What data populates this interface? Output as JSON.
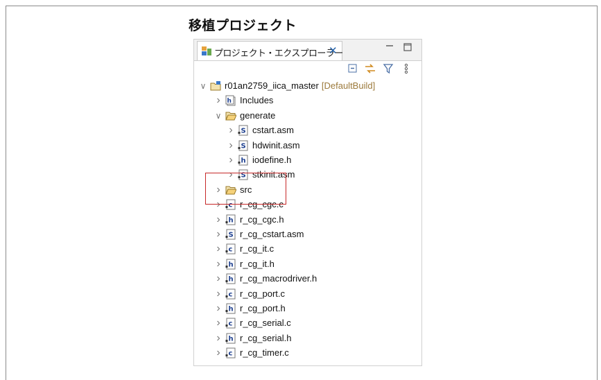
{
  "caption": "移植プロジェクト",
  "view": {
    "tab_label": "プロジェクト・エクスプローラー",
    "close_glyph": "✕",
    "minimize_glyph": "▭",
    "maximize_glyph": "□"
  },
  "tree": {
    "project": {
      "name": "r01an2759_iica_master",
      "decoration": "[DefaultBuild]"
    },
    "items": [
      {
        "label": "Includes",
        "icon": "includes-icon",
        "depth": 1,
        "expanded": false
      },
      {
        "label": "generate",
        "icon": "folder-open-icon",
        "depth": 1,
        "expanded": true
      },
      {
        "label": "cstart.asm",
        "icon": "asm-file-icon",
        "depth": 2,
        "expanded": false
      },
      {
        "label": "hdwinit.asm",
        "icon": "asm-file-icon",
        "depth": 2,
        "expanded": false
      },
      {
        "label": "iodefine.h",
        "icon": "header-file-icon",
        "depth": 2,
        "expanded": false
      },
      {
        "label": "stkinit.asm",
        "icon": "asm-file-icon",
        "depth": 2,
        "expanded": false
      },
      {
        "label": "src",
        "icon": "folder-open-icon",
        "depth": 1,
        "expanded": false
      },
      {
        "label": "r_cg_cgc.c",
        "icon": "c-file-icon",
        "depth": 1,
        "expanded": false
      },
      {
        "label": "r_cg_cgc.h",
        "icon": "header-file-icon",
        "depth": 1,
        "expanded": false
      },
      {
        "label": "r_cg_cstart.asm",
        "icon": "asm-file-icon",
        "depth": 1,
        "expanded": false
      },
      {
        "label": "r_cg_it.c",
        "icon": "c-file-icon",
        "depth": 1,
        "expanded": false
      },
      {
        "label": "r_cg_it.h",
        "icon": "header-file-icon",
        "depth": 1,
        "expanded": false
      },
      {
        "label": "r_cg_macrodriver.h",
        "icon": "header-file-icon",
        "depth": 1,
        "expanded": false
      },
      {
        "label": "r_cg_port.c",
        "icon": "c-file-icon",
        "depth": 1,
        "expanded": false
      },
      {
        "label": "r_cg_port.h",
        "icon": "header-file-icon",
        "depth": 1,
        "expanded": false
      },
      {
        "label": "r_cg_serial.c",
        "icon": "c-file-icon",
        "depth": 1,
        "expanded": false
      },
      {
        "label": "r_cg_serial.h",
        "icon": "header-file-icon",
        "depth": 1,
        "expanded": false
      },
      {
        "label": "r_cg_timer.c",
        "icon": "c-file-icon",
        "depth": 1,
        "expanded": false
      }
    ]
  },
  "colors": {
    "highlight_box": "#c62828",
    "decoration": "#9c7a3c",
    "close_blue": "#1f5ea8"
  }
}
